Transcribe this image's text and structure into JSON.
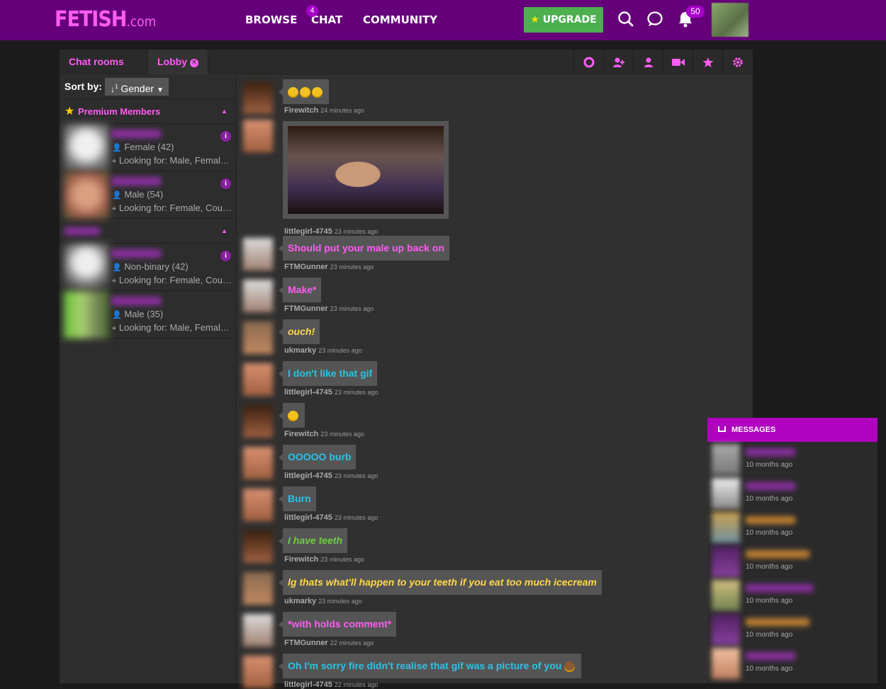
{
  "header": {
    "logo_main": "FETISH",
    "logo_suffix": ".com",
    "nav": [
      "BROWSE",
      "CHAT",
      "COMMUNITY"
    ],
    "chat_badge": "4",
    "upgrade_label": "UPGRADE",
    "notification_count": "50"
  },
  "tabs": {
    "rooms_list": "Chat rooms list",
    "lobby": "Lobby"
  },
  "sidebar": {
    "sort_label": "Sort by:",
    "sort_value": "Gender",
    "premium_title": "Premium Members",
    "members": [
      {
        "line1": "Female (42)",
        "line2": "Looking for: Male, Female, ..."
      },
      {
        "line1": "Male (54)",
        "line2": "Looking for: Female, Couple"
      },
      {
        "line1": "Non-binary (42)",
        "line2": "Looking for: Female, Coupl..."
      },
      {
        "line1": "Male (35)",
        "line2": "Looking for: Male, Female, ..."
      }
    ]
  },
  "chat": {
    "messages": [
      {
        "user": "Firewitch",
        "time": "24 minutes ago",
        "text": "",
        "style": "emoji3"
      },
      {
        "user": "littlegirl-4745",
        "time": "23 minutes ago",
        "text": "",
        "style": "gif"
      },
      {
        "user": "FTMGunner",
        "time": "23 minutes ago",
        "text": "Should put your male up back on",
        "style": "pink"
      },
      {
        "user": "FTMGunner",
        "time": "23 minutes ago",
        "text": "Make*",
        "style": "pink"
      },
      {
        "user": "ukmarky",
        "time": "23 minutes ago",
        "text": "ouch!",
        "style": "yellow"
      },
      {
        "user": "littlegirl-4745",
        "time": "23 minutes ago",
        "text": "I don't like that gif",
        "style": "blue"
      },
      {
        "user": "Firewitch",
        "time": "23 minutes ago",
        "text": "",
        "style": "emoji1"
      },
      {
        "user": "littlegirl-4745",
        "time": "23 minutes ago",
        "text": "OOOOO burb",
        "style": "blue"
      },
      {
        "user": "littlegirl-4745",
        "time": "23 minutes ago",
        "text": "Burn",
        "style": "blue"
      },
      {
        "user": "Firewitch",
        "time": "23 minutes ago",
        "text": "I have teeth",
        "style": "green"
      },
      {
        "user": "ukmarky",
        "time": "23 minutes ago",
        "text": "lg thats what'll happen to your teeth if you eat too much icecream",
        "style": "yellow"
      },
      {
        "user": "FTMGunner",
        "time": "22 minutes ago",
        "text": "*with holds comment*",
        "style": "pink"
      },
      {
        "user": "littlegirl-4745",
        "time": "22 minutes ago",
        "text": "Oh I'm sorry fire didn't realise that gif was a picture of you",
        "style": "blue"
      }
    ]
  },
  "messages_panel": {
    "title": "MESSAGES",
    "threads": [
      {
        "time": "10 months ago"
      },
      {
        "time": "10 months ago"
      },
      {
        "time": "10 months ago"
      },
      {
        "time": "10 months ago"
      },
      {
        "time": "10 months ago"
      },
      {
        "time": "10 months ago"
      },
      {
        "time": "10 months ago"
      }
    ]
  },
  "colors": {
    "brand": "#66007a",
    "accent_pink": "#ff5cf2",
    "upgrade_green": "#4caf50"
  }
}
